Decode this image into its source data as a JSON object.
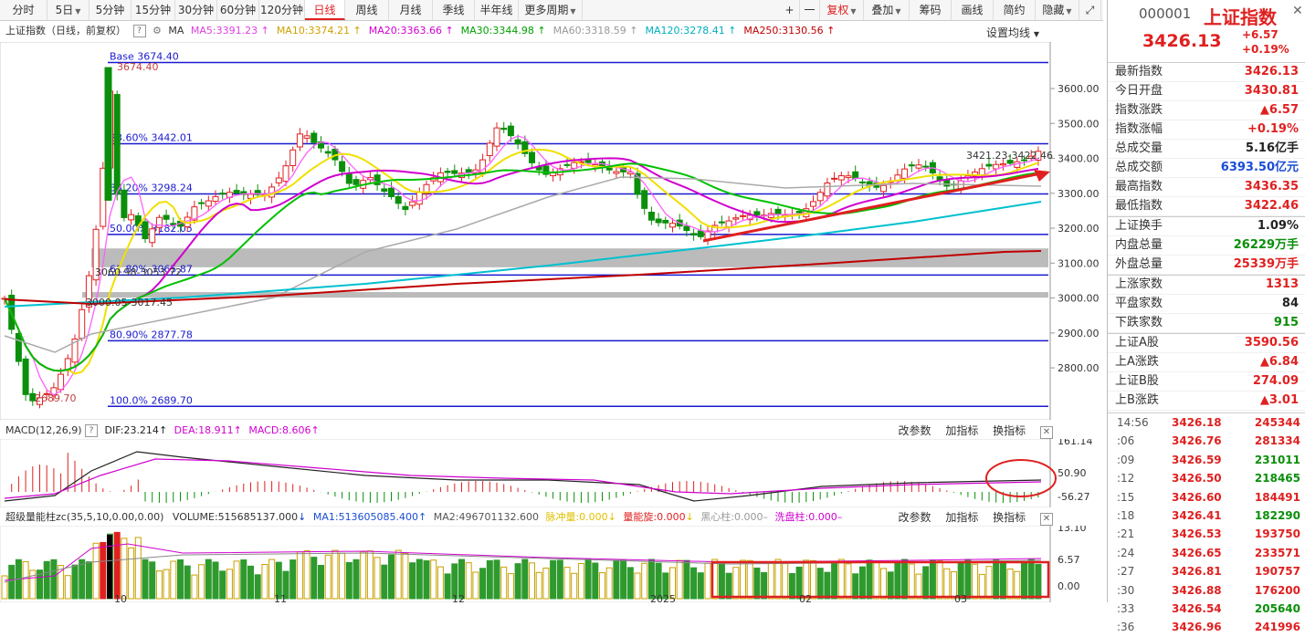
{
  "toolbar": {
    "periods": [
      "分时",
      "5日",
      "5分钟",
      "15分钟",
      "30分钟",
      "60分钟",
      "120分钟",
      "日线",
      "周线",
      "月线",
      "季线",
      "半年线",
      "更多周期"
    ],
    "right_buttons": [
      "+",
      "一",
      "复权",
      "叠加",
      "筹码",
      "画线",
      "简约",
      "隐藏"
    ]
  },
  "main_header": {
    "title": "上证指数（日线，前复权）",
    "ma_label": "MA",
    "ma_items": [
      {
        "text": "MA5:3391.23",
        "color": "#e040e0"
      },
      {
        "text": "MA10:3374.21",
        "color": "#d0a000"
      },
      {
        "text": "MA20:3363.66",
        "color": "#d000d0"
      },
      {
        "text": "MA30:3344.98",
        "color": "#00a000"
      },
      {
        "text": "MA60:3318.59",
        "color": "#999999"
      },
      {
        "text": "MA120:3278.41",
        "color": "#00b0c0"
      },
      {
        "text": "MA250:3130.56",
        "color": "#c00000"
      }
    ],
    "settings": "设置均线"
  },
  "price_axis": [
    "3600.00",
    "3500.00",
    "3400.00",
    "3300.00",
    "3200.00",
    "3100.00",
    "3000.00",
    "2900.00",
    "2800.00"
  ],
  "fib_labels": [
    "Base   3674.40",
    "23.60% 3442.01",
    "38.20% 3298.24",
    "50.00% 3182.05",
    "61.80% 3065.87",
    "80.90% 2877.78",
    "100.0% 2689.70"
  ],
  "annotations": {
    "high": "3674.40",
    "low": "2689.70",
    "range_left": "3000.05-3017.45",
    "range_left2": "3060.98-3053.72",
    "right_range": "3421.23-3422.46"
  },
  "macd": {
    "title": "MACD(12,26,9)",
    "dif": "DIF:23.214",
    "dea": "DEA:18.911",
    "macd": "MACD:8.606",
    "axis": [
      "161.14",
      "50.90",
      "-56.27"
    ],
    "buttons": [
      "改参数",
      "加指标",
      "换指标"
    ]
  },
  "volume": {
    "title": "超级量能柱zc(35,5,10,0.00,0.00)",
    "vol": "VOLUME:515685137.000",
    "ma1": "MA1:513605085.400",
    "ma2": "MA2:496701132.600",
    "x1": "脉冲量:0.000",
    "x2": "量能旋:0.000",
    "x3": "黑心柱:0.000",
    "x4": "洗盘柱:0.000",
    "axis": [
      "13.10",
      "6.57",
      "0.00"
    ],
    "buttons": [
      "改参数",
      "加指标",
      "换指标"
    ]
  },
  "symbol": {
    "code": "000001",
    "name": "上证指数",
    "price": "3426.13",
    "change": "+6.57",
    "change_pct": "+0.19%"
  },
  "stats": [
    {
      "label": "最新指数",
      "value": "3426.13",
      "color": "red"
    },
    {
      "label": "今日开盘",
      "value": "3430.81",
      "color": "red"
    },
    {
      "label": "指数涨跌",
      "value": "▲6.57",
      "color": "red"
    },
    {
      "label": "指数涨幅",
      "value": "+0.19%",
      "color": "red"
    },
    {
      "label": "总成交量",
      "value": "5.16亿手",
      "color": "black"
    },
    {
      "label": "总成交额",
      "value": "6393.50亿元",
      "color": "blue"
    },
    {
      "label": "最高指数",
      "value": "3436.35",
      "color": "red"
    },
    {
      "label": "最低指数",
      "value": "3422.46",
      "color": "red"
    },
    {
      "label": "上证换手",
      "value": "1.09%",
      "color": "black"
    },
    {
      "label": "内盘总量",
      "value": "26229万手",
      "color": "green"
    },
    {
      "label": "外盘总量",
      "value": "25339万手",
      "color": "red"
    },
    {
      "label": "上涨家数",
      "value": "1313",
      "color": "red"
    },
    {
      "label": "平盘家数",
      "value": "84",
      "color": "black"
    },
    {
      "label": "下跌家数",
      "value": "915",
      "color": "green"
    },
    {
      "label": "上证A股",
      "value": "3590.56",
      "color": "red"
    },
    {
      "label": "上A涨跌",
      "value": "▲6.84",
      "color": "red"
    },
    {
      "label": "上证B股",
      "value": "274.09",
      "color": "red"
    },
    {
      "label": "上B涨跌",
      "value": "▲3.01",
      "color": "red"
    }
  ],
  "ticks": [
    {
      "t": "14:56",
      "p": "3426.18",
      "v": "245344",
      "c": "red"
    },
    {
      "t": ":06",
      "p": "3426.76",
      "v": "281334",
      "c": "red"
    },
    {
      "t": ":09",
      "p": "3426.59",
      "v": "231011",
      "c": "green"
    },
    {
      "t": ":12",
      "p": "3426.50",
      "v": "218465",
      "c": "green"
    },
    {
      "t": ":15",
      "p": "3426.60",
      "v": "184491",
      "c": "red"
    },
    {
      "t": ":18",
      "p": "3426.41",
      "v": "182290",
      "c": "green"
    },
    {
      "t": ":21",
      "p": "3426.53",
      "v": "193750",
      "c": "red"
    },
    {
      "t": ":24",
      "p": "3426.65",
      "v": "233571",
      "c": "red"
    },
    {
      "t": ":27",
      "p": "3426.81",
      "v": "190757",
      "c": "red"
    },
    {
      "t": ":30",
      "p": "3426.88",
      "v": "176200",
      "c": "red"
    },
    {
      "t": ":33",
      "p": "3426.54",
      "v": "205640",
      "c": "green"
    },
    {
      "t": ":36",
      "p": "3426.96",
      "v": "241996",
      "c": "red"
    }
  ],
  "xaxis": [
    "10",
    "11",
    "12",
    "2025",
    "02",
    "03"
  ]
}
